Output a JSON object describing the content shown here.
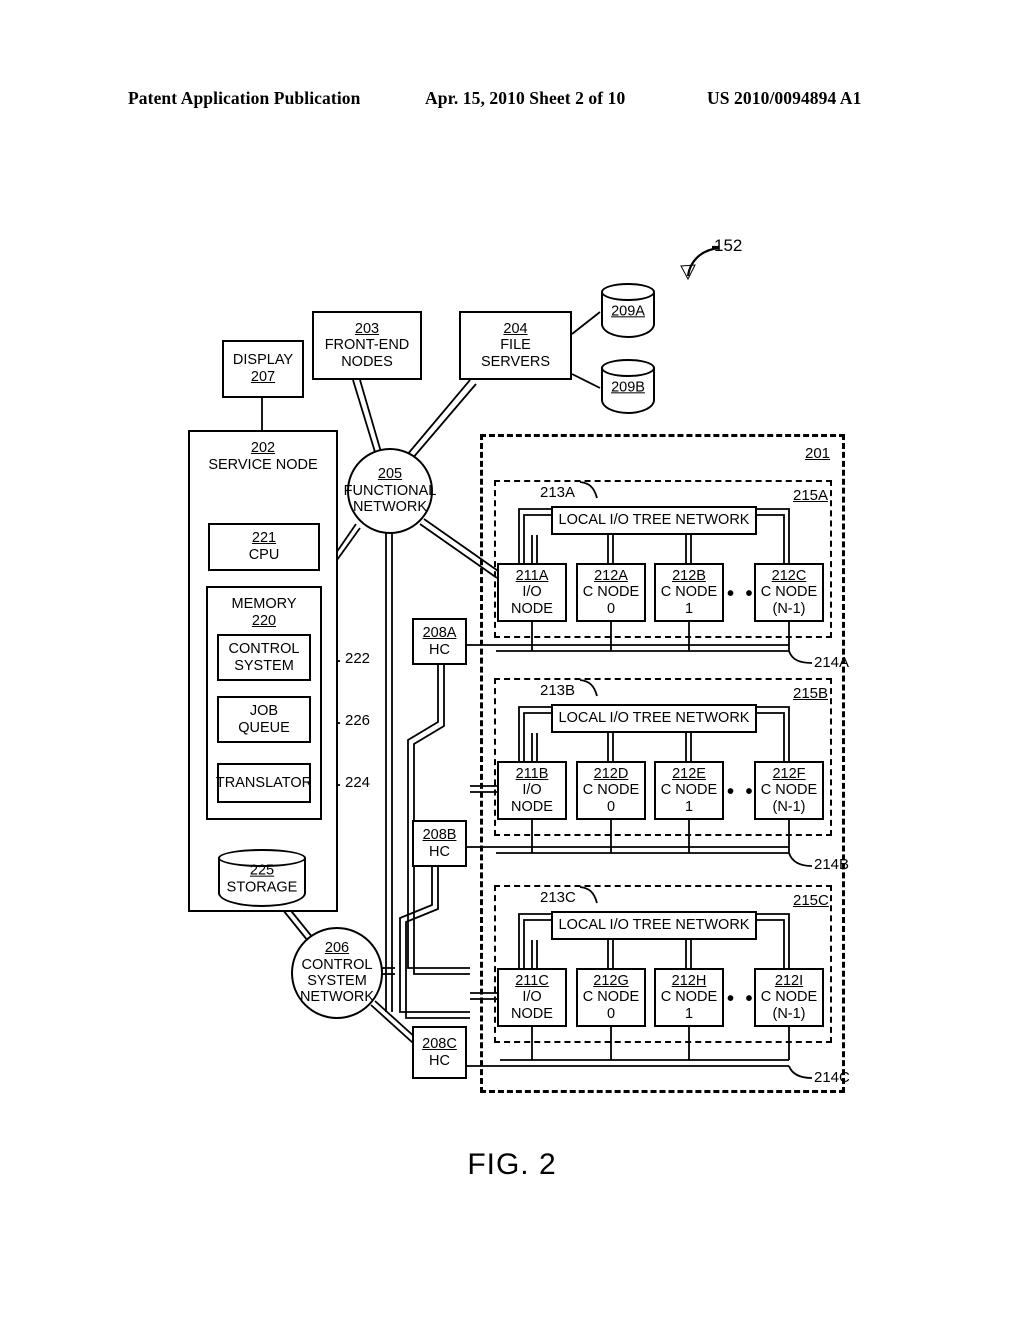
{
  "header": {
    "publication": "Patent Application Publication",
    "date_sheet": "Apr. 15, 2010  Sheet 2 of 10",
    "patent_number": "US 2010/0094894 A1"
  },
  "figure": {
    "caption": "FIG. 2",
    "system_ref": "152"
  },
  "boxes": {
    "display": {
      "ref": "207",
      "label": "DISPLAY"
    },
    "front_end": {
      "ref": "203",
      "line1": "FRONT-END",
      "line2": "NODES"
    },
    "file_servers": {
      "ref": "204",
      "line1": "FILE",
      "line2": "SERVERS"
    },
    "service_node": {
      "ref": "202",
      "label": "SERVICE NODE"
    },
    "cpu": {
      "ref": "221",
      "label": "CPU"
    },
    "memory": {
      "ref": "220",
      "label": "MEMORY"
    },
    "control_system": {
      "ref": "222",
      "line1": "CONTROL",
      "line2": "SYSTEM"
    },
    "job_queue": {
      "ref": "226",
      "line1": "JOB",
      "line2": "QUEUE"
    },
    "translator": {
      "ref": "224",
      "label": "TRANSLATOR"
    }
  },
  "storage": {
    "ref": "225",
    "label": "STORAGE"
  },
  "disks": [
    {
      "ref": "209A"
    },
    {
      "ref": "209B"
    }
  ],
  "networks": {
    "functional": {
      "ref": "205",
      "line1": "FUNCTIONAL",
      "line2": "NETWORK"
    },
    "control": {
      "ref": "206",
      "line1": "CONTROL",
      "line2": "SYSTEM",
      "line3": "NETWORK"
    }
  },
  "hardware_controllers": [
    {
      "ref": "208A",
      "label": "HC"
    },
    {
      "ref": "208B",
      "label": "HC"
    },
    {
      "ref": "208C",
      "label": "HC"
    }
  ],
  "compute_core": {
    "ref": "201"
  },
  "racks": [
    {
      "ref": "215A",
      "tree_ref": "213A",
      "tree_label": "LOCAL I/O TREE NETWORK",
      "bus_ref": "214A",
      "nodes": [
        {
          "ref": "211A",
          "line1": "I/O",
          "line2": "NODE"
        },
        {
          "ref": "212A",
          "line1": "C NODE",
          "line2": "0"
        },
        {
          "ref": "212B",
          "line1": "C NODE",
          "line2": "1"
        },
        {
          "ref": "212C",
          "line1": "C NODE",
          "line2": "(N-1)"
        }
      ],
      "ellipsis": "• • •"
    },
    {
      "ref": "215B",
      "tree_ref": "213B",
      "tree_label": "LOCAL I/O TREE NETWORK",
      "bus_ref": "214B",
      "nodes": [
        {
          "ref": "211B",
          "line1": "I/O",
          "line2": "NODE"
        },
        {
          "ref": "212D",
          "line1": "C NODE",
          "line2": "0"
        },
        {
          "ref": "212E",
          "line1": "C NODE",
          "line2": "1"
        },
        {
          "ref": "212F",
          "line1": "C NODE",
          "line2": "(N-1)"
        }
      ],
      "ellipsis": "• • •"
    },
    {
      "ref": "215C",
      "tree_ref": "213C",
      "tree_label": "LOCAL I/O TREE NETWORK",
      "bus_ref": "214C",
      "nodes": [
        {
          "ref": "211C",
          "line1": "I/O",
          "line2": "NODE"
        },
        {
          "ref": "212G",
          "line1": "C NODE",
          "line2": "0"
        },
        {
          "ref": "212H",
          "line1": "C NODE",
          "line2": "1"
        },
        {
          "ref": "212I",
          "line1": "C NODE",
          "line2": "(N-1)"
        }
      ],
      "ellipsis": "• • •"
    }
  ],
  "colors": {
    "ink": "#000000",
    "paper": "#ffffff"
  }
}
